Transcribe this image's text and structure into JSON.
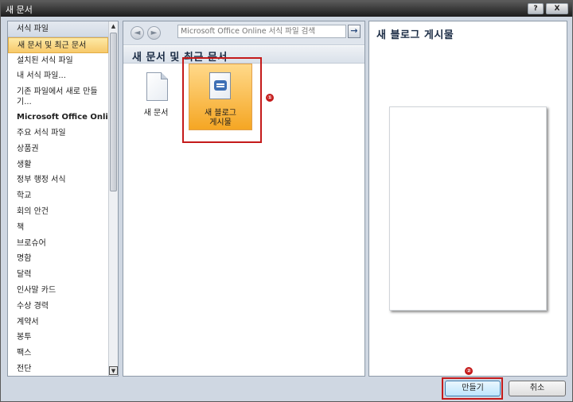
{
  "window": {
    "title": "새 문서",
    "help_label": "?",
    "close_label": "X"
  },
  "categories": {
    "header": "서식 파일",
    "items": [
      "새 문서 및 최근 문서",
      "설치된 서식 파일",
      "내 서식 파일...",
      "기존 파일에서 새로 만들기...",
      "Microsoft Office Online",
      "주요 서식 파일",
      "상품권",
      "생활",
      "정부 행정 서식",
      "학교",
      "회의 안건",
      "책",
      "브로슈어",
      "명함",
      "달력",
      "인사말 카드",
      "수상 경력",
      "계약서",
      "봉투",
      "팩스",
      "전단"
    ],
    "selected_index": 0,
    "bold_index": 4
  },
  "toolbar": {
    "back_icon": "◄",
    "forward_icon": "►",
    "search_placeholder": "Microsoft Office Online 서식 파일 검색",
    "go_icon": "→"
  },
  "center": {
    "section_title": "새 문서 및 최근 문서",
    "tiles": [
      {
        "label": "새 문서",
        "icon": "blank-document-icon"
      },
      {
        "label": "새 블로그\n게시물",
        "icon": "blog-post-icon"
      }
    ],
    "marker_1": "①"
  },
  "preview": {
    "title": "새 블로그 게시물"
  },
  "buttons": {
    "create": "만들기",
    "cancel": "취소",
    "marker_2": "②"
  },
  "colors": {
    "accent_orange": "#f5a623",
    "highlight_red": "#c41a1a",
    "selection_yellow": "#fde9a6"
  }
}
